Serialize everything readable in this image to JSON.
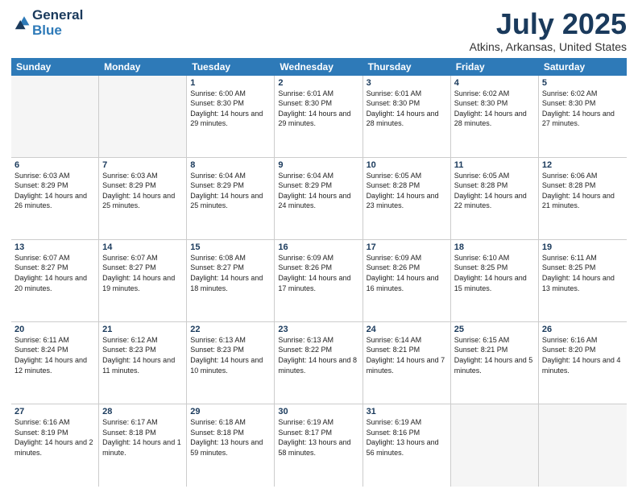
{
  "header": {
    "logo_line1": "General",
    "logo_line2": "Blue",
    "month": "July 2025",
    "location": "Atkins, Arkansas, United States"
  },
  "days_of_week": [
    "Sunday",
    "Monday",
    "Tuesday",
    "Wednesday",
    "Thursday",
    "Friday",
    "Saturday"
  ],
  "weeks": [
    [
      {
        "day": "",
        "info": ""
      },
      {
        "day": "",
        "info": ""
      },
      {
        "day": "1",
        "info": "Sunrise: 6:00 AM\nSunset: 8:30 PM\nDaylight: 14 hours and 29 minutes."
      },
      {
        "day": "2",
        "info": "Sunrise: 6:01 AM\nSunset: 8:30 PM\nDaylight: 14 hours and 29 minutes."
      },
      {
        "day": "3",
        "info": "Sunrise: 6:01 AM\nSunset: 8:30 PM\nDaylight: 14 hours and 28 minutes."
      },
      {
        "day": "4",
        "info": "Sunrise: 6:02 AM\nSunset: 8:30 PM\nDaylight: 14 hours and 28 minutes."
      },
      {
        "day": "5",
        "info": "Sunrise: 6:02 AM\nSunset: 8:30 PM\nDaylight: 14 hours and 27 minutes."
      }
    ],
    [
      {
        "day": "6",
        "info": "Sunrise: 6:03 AM\nSunset: 8:29 PM\nDaylight: 14 hours and 26 minutes."
      },
      {
        "day": "7",
        "info": "Sunrise: 6:03 AM\nSunset: 8:29 PM\nDaylight: 14 hours and 25 minutes."
      },
      {
        "day": "8",
        "info": "Sunrise: 6:04 AM\nSunset: 8:29 PM\nDaylight: 14 hours and 25 minutes."
      },
      {
        "day": "9",
        "info": "Sunrise: 6:04 AM\nSunset: 8:29 PM\nDaylight: 14 hours and 24 minutes."
      },
      {
        "day": "10",
        "info": "Sunrise: 6:05 AM\nSunset: 8:28 PM\nDaylight: 14 hours and 23 minutes."
      },
      {
        "day": "11",
        "info": "Sunrise: 6:05 AM\nSunset: 8:28 PM\nDaylight: 14 hours and 22 minutes."
      },
      {
        "day": "12",
        "info": "Sunrise: 6:06 AM\nSunset: 8:28 PM\nDaylight: 14 hours and 21 minutes."
      }
    ],
    [
      {
        "day": "13",
        "info": "Sunrise: 6:07 AM\nSunset: 8:27 PM\nDaylight: 14 hours and 20 minutes."
      },
      {
        "day": "14",
        "info": "Sunrise: 6:07 AM\nSunset: 8:27 PM\nDaylight: 14 hours and 19 minutes."
      },
      {
        "day": "15",
        "info": "Sunrise: 6:08 AM\nSunset: 8:27 PM\nDaylight: 14 hours and 18 minutes."
      },
      {
        "day": "16",
        "info": "Sunrise: 6:09 AM\nSunset: 8:26 PM\nDaylight: 14 hours and 17 minutes."
      },
      {
        "day": "17",
        "info": "Sunrise: 6:09 AM\nSunset: 8:26 PM\nDaylight: 14 hours and 16 minutes."
      },
      {
        "day": "18",
        "info": "Sunrise: 6:10 AM\nSunset: 8:25 PM\nDaylight: 14 hours and 15 minutes."
      },
      {
        "day": "19",
        "info": "Sunrise: 6:11 AM\nSunset: 8:25 PM\nDaylight: 14 hours and 13 minutes."
      }
    ],
    [
      {
        "day": "20",
        "info": "Sunrise: 6:11 AM\nSunset: 8:24 PM\nDaylight: 14 hours and 12 minutes."
      },
      {
        "day": "21",
        "info": "Sunrise: 6:12 AM\nSunset: 8:23 PM\nDaylight: 14 hours and 11 minutes."
      },
      {
        "day": "22",
        "info": "Sunrise: 6:13 AM\nSunset: 8:23 PM\nDaylight: 14 hours and 10 minutes."
      },
      {
        "day": "23",
        "info": "Sunrise: 6:13 AM\nSunset: 8:22 PM\nDaylight: 14 hours and 8 minutes."
      },
      {
        "day": "24",
        "info": "Sunrise: 6:14 AM\nSunset: 8:21 PM\nDaylight: 14 hours and 7 minutes."
      },
      {
        "day": "25",
        "info": "Sunrise: 6:15 AM\nSunset: 8:21 PM\nDaylight: 14 hours and 5 minutes."
      },
      {
        "day": "26",
        "info": "Sunrise: 6:16 AM\nSunset: 8:20 PM\nDaylight: 14 hours and 4 minutes."
      }
    ],
    [
      {
        "day": "27",
        "info": "Sunrise: 6:16 AM\nSunset: 8:19 PM\nDaylight: 14 hours and 2 minutes."
      },
      {
        "day": "28",
        "info": "Sunrise: 6:17 AM\nSunset: 8:18 PM\nDaylight: 14 hours and 1 minute."
      },
      {
        "day": "29",
        "info": "Sunrise: 6:18 AM\nSunset: 8:18 PM\nDaylight: 13 hours and 59 minutes."
      },
      {
        "day": "30",
        "info": "Sunrise: 6:19 AM\nSunset: 8:17 PM\nDaylight: 13 hours and 58 minutes."
      },
      {
        "day": "31",
        "info": "Sunrise: 6:19 AM\nSunset: 8:16 PM\nDaylight: 13 hours and 56 minutes."
      },
      {
        "day": "",
        "info": ""
      },
      {
        "day": "",
        "info": ""
      }
    ]
  ]
}
